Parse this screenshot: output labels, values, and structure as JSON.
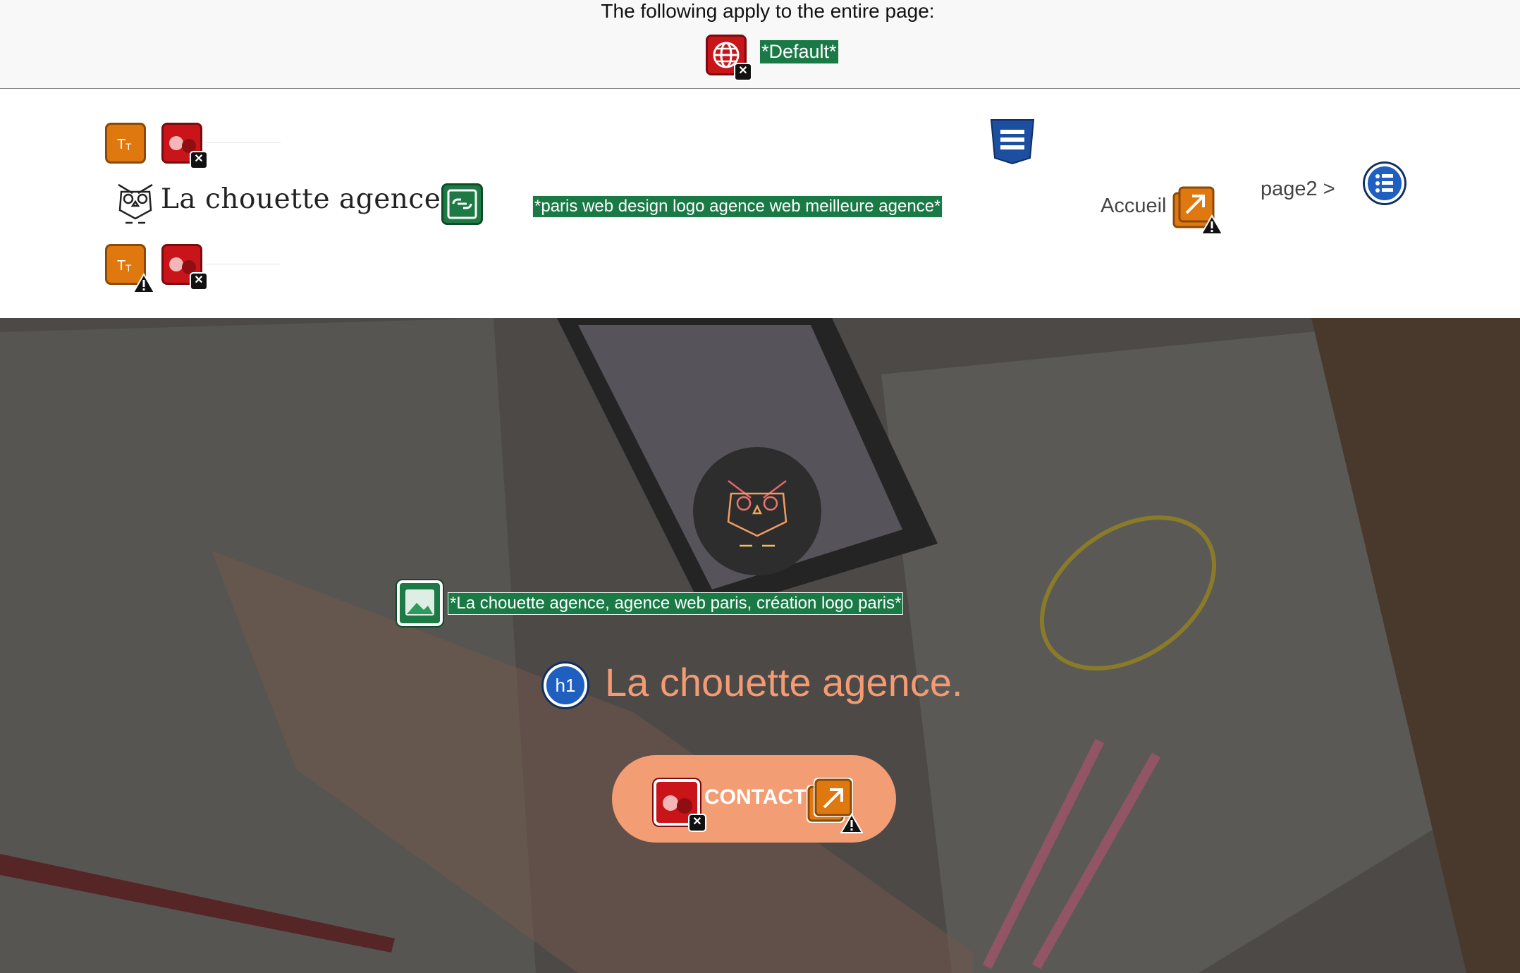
{
  "banner": {
    "text": "The following apply to the entire page:",
    "language_label": "*Default*"
  },
  "header": {
    "logo_text": "La chouette agence",
    "logo_alt": "*paris web design logo agence web meilleure agence*",
    "nav": [
      {
        "label": "Accueil"
      },
      {
        "label": "page2 >"
      }
    ]
  },
  "hero": {
    "image_alt": "*La chouette agence, agence web paris, création logo paris*",
    "h1_badge": "h1",
    "title": "La chouette agence.",
    "cta_label": "CONTACT"
  },
  "colors": {
    "accent": "#f29d74",
    "title": "#f39b73",
    "error": "#c9141a",
    "alert": "#e07810",
    "feature": "#1d7a45",
    "structure": "#1f5fbf"
  },
  "icons": {
    "error": "error-icon",
    "alert": "alert-icon",
    "feature": "image-icon",
    "structure": "list-icon",
    "language": "globe-icon",
    "css": "css-icon"
  }
}
